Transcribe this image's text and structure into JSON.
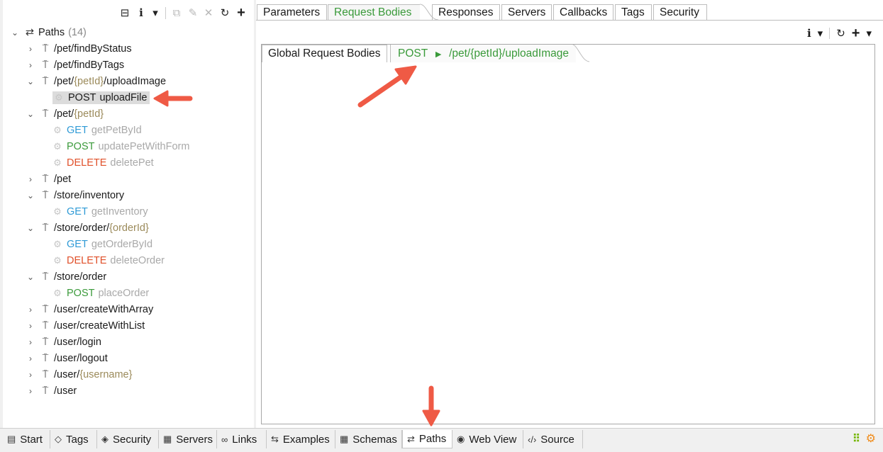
{
  "left": {
    "toolbar": {
      "collapse": "⊟",
      "info": "i",
      "dropdown": "▾",
      "copy": "⧉",
      "edit": "✎",
      "delete": "✕",
      "refresh": "↻",
      "add": "+"
    },
    "root": {
      "label": "Paths",
      "count": "(14)"
    },
    "tree": [
      {
        "kind": "path",
        "chev": "›",
        "parts": [
          {
            "t": "/pet/findByStatus"
          }
        ]
      },
      {
        "kind": "path",
        "chev": "›",
        "parts": [
          {
            "t": "/pet/findByTags"
          }
        ]
      },
      {
        "kind": "path",
        "chev": "⌄",
        "parts": [
          {
            "t": "/pet/"
          },
          {
            "t": "{petId}",
            "c": "param"
          },
          {
            "t": "/uploadImage"
          }
        ]
      },
      {
        "kind": "op",
        "selected": true,
        "method": "POST",
        "op": "uploadFile"
      },
      {
        "kind": "path",
        "chev": "⌄",
        "parts": [
          {
            "t": "/pet/"
          },
          {
            "t": "{petId}",
            "c": "param"
          }
        ]
      },
      {
        "kind": "op",
        "method": "GET",
        "color": "#2f9ad6",
        "op": "getPetById"
      },
      {
        "kind": "op",
        "method": "POST",
        "color": "#3b9a3b",
        "op": "updatePetWithForm"
      },
      {
        "kind": "op",
        "method": "DELETE",
        "color": "#e0502a",
        "op": "deletePet"
      },
      {
        "kind": "path",
        "chev": "›",
        "parts": [
          {
            "t": "/pet"
          }
        ]
      },
      {
        "kind": "path",
        "chev": "⌄",
        "parts": [
          {
            "t": "/store/inventory"
          }
        ]
      },
      {
        "kind": "op",
        "method": "GET",
        "color": "#2f9ad6",
        "op": "getInventory"
      },
      {
        "kind": "path",
        "chev": "⌄",
        "parts": [
          {
            "t": "/store/order/"
          },
          {
            "t": "{orderId}",
            "c": "param"
          }
        ]
      },
      {
        "kind": "op",
        "method": "GET",
        "color": "#2f9ad6",
        "op": "getOrderById"
      },
      {
        "kind": "op",
        "method": "DELETE",
        "color": "#e0502a",
        "op": "deleteOrder"
      },
      {
        "kind": "path",
        "chev": "⌄",
        "parts": [
          {
            "t": "/store/order"
          }
        ]
      },
      {
        "kind": "op",
        "method": "POST",
        "color": "#3b9a3b",
        "op": "placeOrder"
      },
      {
        "kind": "path",
        "chev": "›",
        "parts": [
          {
            "t": "/user/createWithArray"
          }
        ]
      },
      {
        "kind": "path",
        "chev": "›",
        "parts": [
          {
            "t": "/user/createWithList"
          }
        ]
      },
      {
        "kind": "path",
        "chev": "›",
        "parts": [
          {
            "t": "/user/login"
          }
        ]
      },
      {
        "kind": "path",
        "chev": "›",
        "parts": [
          {
            "t": "/user/logout"
          }
        ]
      },
      {
        "kind": "path",
        "chev": "›",
        "parts": [
          {
            "t": "/user/"
          },
          {
            "t": "{username}",
            "c": "param"
          }
        ]
      },
      {
        "kind": "path",
        "chev": "›",
        "parts": [
          {
            "t": "/user"
          }
        ]
      }
    ]
  },
  "right": {
    "tabs": [
      "Parameters",
      "Request Bodies",
      "Responses",
      "Servers",
      "Callbacks",
      "Tags",
      "Security"
    ],
    "active_tab": "Request Bodies",
    "toolbar": {
      "info": "i",
      "dropdown": "▾",
      "refresh": "↻",
      "add": "+",
      "add_dropdown": "▾"
    },
    "subtabs": {
      "global": "Global Request Bodies",
      "active_method": "POST",
      "active_arrow": "►",
      "active_path": "/pet/{petId}/uploadImage"
    }
  },
  "bottom": {
    "tabs": [
      {
        "label": "Start",
        "icon": "▤"
      },
      {
        "label": "Tags",
        "icon": "◇"
      },
      {
        "label": "Security",
        "icon": "◈"
      },
      {
        "label": "Servers",
        "icon": "▦"
      },
      {
        "label": "Links",
        "icon": "∞"
      },
      {
        "label": "Examples",
        "icon": "⇆"
      },
      {
        "label": "Schemas",
        "icon": "▦"
      },
      {
        "label": "Paths",
        "icon": "⇄"
      },
      {
        "label": "Web View",
        "icon": "◉"
      },
      {
        "label": "Source",
        "icon": "‹/›"
      }
    ],
    "active": "Paths"
  },
  "colors": {
    "accent_green": "#3a9a3a",
    "arrow_red": "#ef5a45",
    "get": "#2f9ad6",
    "post": "#3b9a3b",
    "delete": "#e0502a"
  }
}
